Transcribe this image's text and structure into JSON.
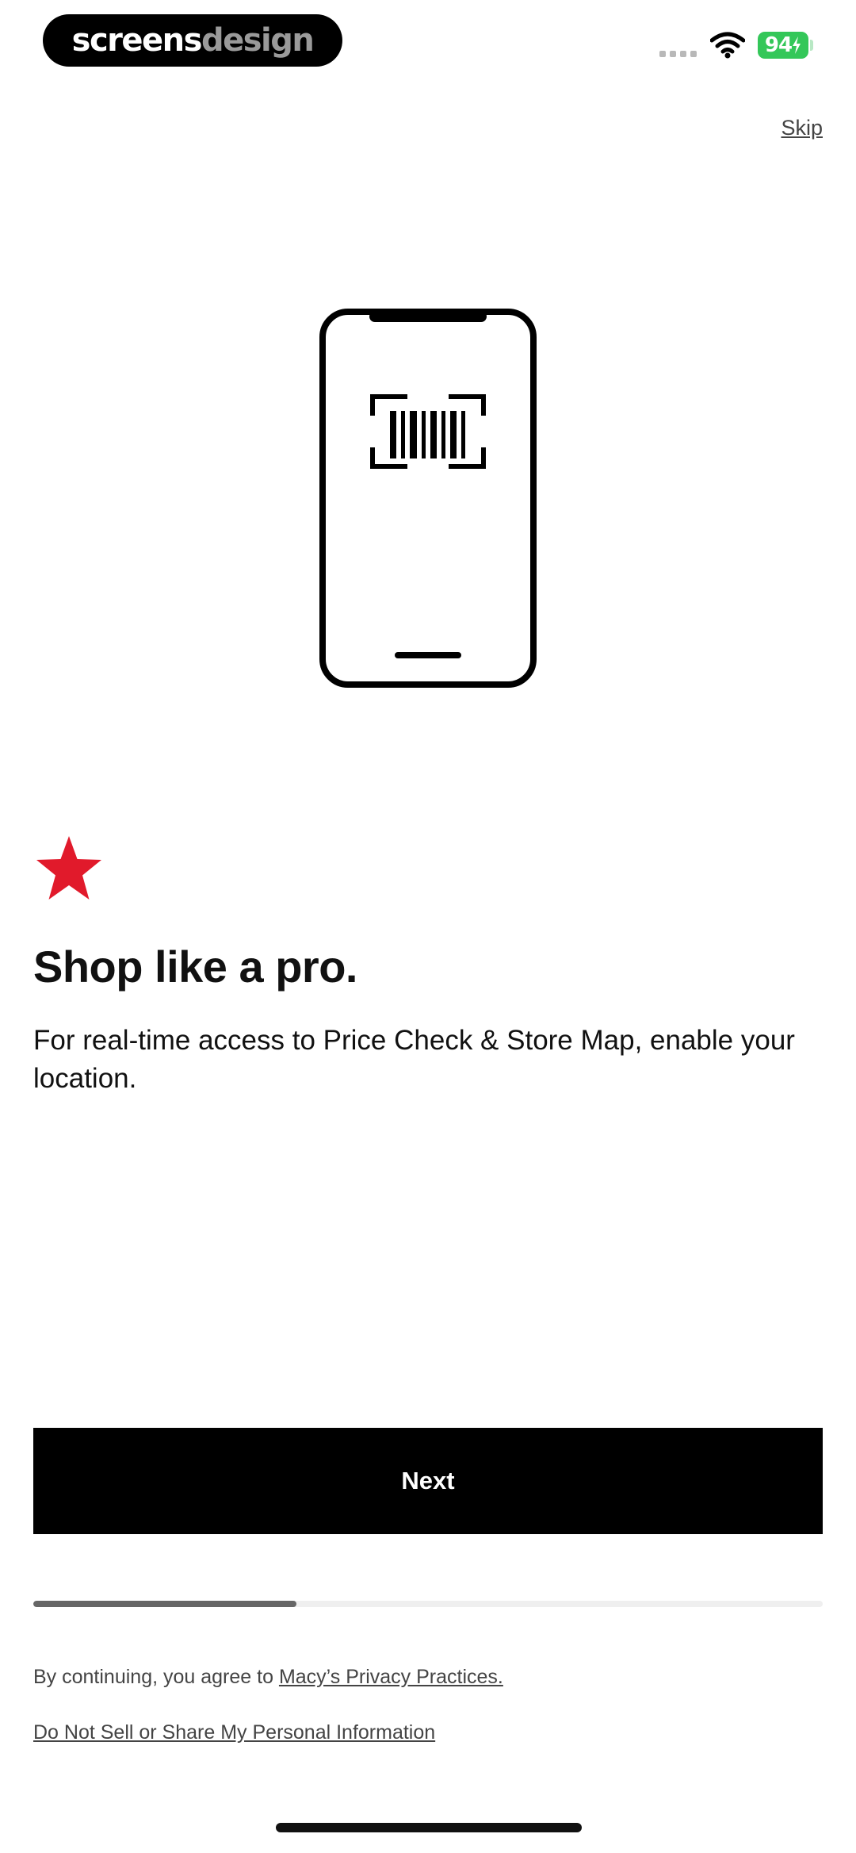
{
  "status_bar": {
    "brand_part1": "screens",
    "brand_part2": "design",
    "battery_level": "94"
  },
  "header": {
    "skip_label": "Skip"
  },
  "onboarding": {
    "headline": "Shop like a pro.",
    "subtitle": "For real-time access to Price Check & Store Map, enable your location.",
    "next_label": "Next",
    "progress_fraction": 0.333
  },
  "legal": {
    "prefix": "By continuing, you agree to ",
    "privacy_link": "Macy’s Privacy Practices.",
    "do_not_sell_link": "Do Not Sell or Share My Personal Information"
  },
  "colors": {
    "star_red": "#e11a2b",
    "battery_green": "#34c759",
    "button_black": "#000000"
  },
  "icons": {
    "brand": "red-star-icon",
    "illustration": "phone-barcode-scanner-icon"
  }
}
